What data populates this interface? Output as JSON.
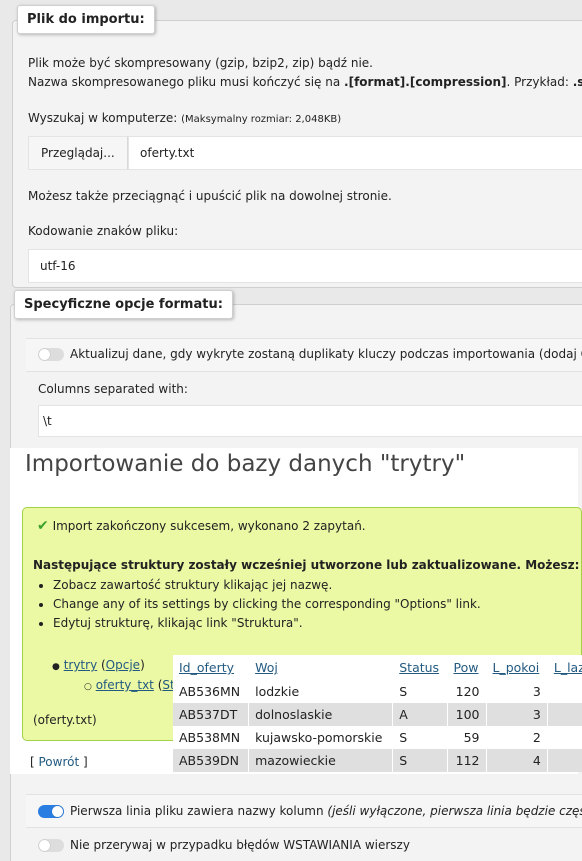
{
  "file_section": {
    "legend": "Plik do importu:",
    "compress_line1": "Plik może być skompresowany (gzip, bzip2, zip) bądź nie.",
    "compress_line2_a": "Nazwa skompresowanego pliku musi kończyć się na ",
    "compress_line2_b": ".[format].[compression]",
    "compress_line2_c": ". Przykład: ",
    "compress_line2_d": ".sql.z",
    "browse_label": "Wyszukaj w komputerze:",
    "max_size": "(Maksymalny rozmiar: 2,048KB)",
    "browse_button": "Przeglądaj...",
    "file_name": "oferty.txt",
    "drag_hint": "Możesz także przeciągnąć i upuścić plik na dowolnej stronie.",
    "encoding_label": "Kodowanie znaków pliku:",
    "encoding_value": "utf-16"
  },
  "format_section": {
    "legend": "Specyficzne opcje formatu:",
    "update_dupes": "Aktualizuj dane, gdy wykryte zostaną duplikaty kluczy podczas importowania (dodaj ON",
    "columns_sep_label": "Columns separated with:",
    "columns_sep_value": "\\t",
    "first_line": "Pierwsza linia pliku zawiera nazwy kolumn",
    "first_line_note": " (jeśli wyłączone, pierwsza linia będzie części",
    "no_abort": "Nie przerywaj w przypadku błędów WSTAWIANIA wierszy"
  },
  "result": {
    "title": "Importowanie do bazy danych \"trytry\"",
    "success_msg": "Import zakończony sukcesem, wykonano 2 zapytań.",
    "structures_heading": "Następujące struktury zostały wcześniej utworzone lub zaktualizowane. Możesz:",
    "bullets": [
      "Zobacz zawartość struktury klikając jej nazwę.",
      "Change any of its settings by clicking the corresponding \"Options\" link.",
      "Edytuj strukturę, klikając link \"Struktura\"."
    ],
    "db_link": "trytry",
    "db_options": "Opcje",
    "table_link": "oferty_txt",
    "table_options_partial": "St",
    "file_note": "(oferty.txt)",
    "back_link": "Powrót"
  },
  "table": {
    "headers": [
      "Id_oferty",
      "Woj",
      "Status",
      "Pow",
      "L_pokoi",
      "L_laz"
    ],
    "rows": [
      [
        "AB536MN",
        "lodzkie",
        "S",
        "120",
        "3",
        ""
      ],
      [
        "AB537DT",
        "dolnoslaskie",
        "A",
        "100",
        "3",
        ""
      ],
      [
        "AB538MN",
        "kujawsko-pomorskie",
        "S",
        "59",
        "2",
        ""
      ],
      [
        "AB539DN",
        "mazowieckie",
        "S",
        "112",
        "4",
        ""
      ]
    ]
  },
  "colors": {
    "accent": "#2a7de1",
    "link": "#235a81",
    "success_bg": "#ebf8a4",
    "success_border": "#a2d246"
  }
}
